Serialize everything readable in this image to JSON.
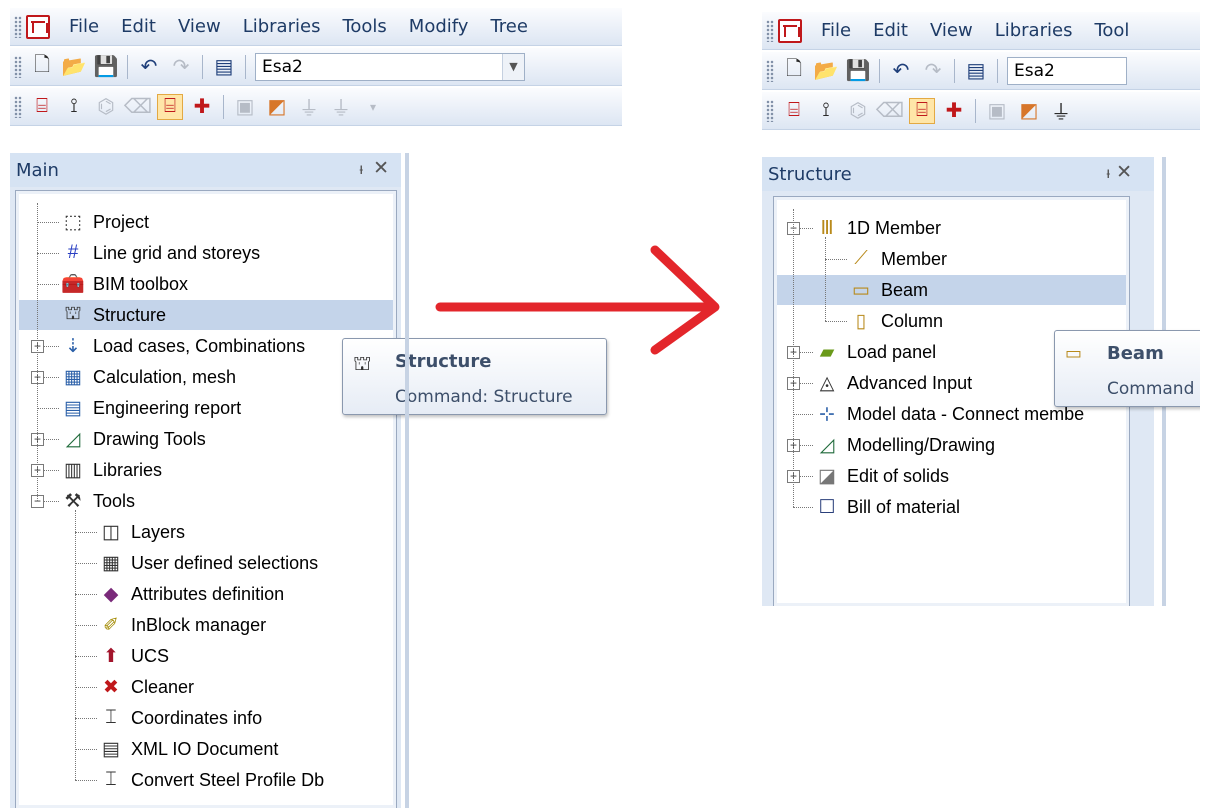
{
  "left": {
    "menu": [
      "File",
      "Edit",
      "View",
      "Libraries",
      "Tools",
      "Modify",
      "Tree"
    ],
    "project_combo": "Esa2",
    "panel_title": "Main",
    "tree": [
      {
        "label": "Project",
        "icon": "project-icon"
      },
      {
        "label": "Line grid and storeys",
        "icon": "grid-icon"
      },
      {
        "label": "BIM toolbox",
        "icon": "toolbox-icon"
      },
      {
        "label": "Structure",
        "icon": "structure-icon",
        "selected": true
      },
      {
        "label": "Load cases, Combinations",
        "icon": "load-icon",
        "expander": "+"
      },
      {
        "label": "Calculation, mesh",
        "icon": "calculator-icon",
        "expander": "+"
      },
      {
        "label": "Engineering report",
        "icon": "report-icon"
      },
      {
        "label": "Drawing Tools",
        "icon": "drawing-icon",
        "expander": "+"
      },
      {
        "label": "Libraries",
        "icon": "library-icon",
        "expander": "+"
      },
      {
        "label": "Tools",
        "icon": "tools-icon",
        "expander": "−"
      },
      {
        "label": "Layers",
        "icon": "layers-icon",
        "child": true
      },
      {
        "label": "User defined selections",
        "icon": "selection-icon",
        "child": true
      },
      {
        "label": "Attributes definition",
        "icon": "attributes-icon",
        "child": true
      },
      {
        "label": "InBlock manager",
        "icon": "inblock-icon",
        "child": true
      },
      {
        "label": "UCS",
        "icon": "ucs-icon",
        "child": true
      },
      {
        "label": "Cleaner",
        "icon": "cleaner-icon",
        "child": true
      },
      {
        "label": "Coordinates info",
        "icon": "coordinates-icon",
        "child": true
      },
      {
        "label": "XML IO Document",
        "icon": "xml-icon",
        "child": true
      },
      {
        "label": "Convert Steel Profile Db",
        "icon": "steel-profile-icon",
        "child": true
      }
    ],
    "tooltip": {
      "title": "Structure",
      "command": "Command: Structure"
    }
  },
  "right": {
    "menu": [
      "File",
      "Edit",
      "View",
      "Libraries",
      "Tool"
    ],
    "project_combo": "Esa2",
    "panel_title": "Structure",
    "tree": [
      {
        "label": "1D Member",
        "icon": "member-1d-icon",
        "expander": "−"
      },
      {
        "label": "Member",
        "icon": "member-icon",
        "child": true
      },
      {
        "label": "Beam",
        "icon": "beam-icon",
        "child": true,
        "selected": true
      },
      {
        "label": "Column",
        "icon": "column-icon",
        "child": true
      },
      {
        "label": "Load panel",
        "icon": "load-panel-icon",
        "expander": "+"
      },
      {
        "label": "Advanced Input",
        "icon": "advanced-input-icon",
        "expander": "+"
      },
      {
        "label": "Model data - Connect membe",
        "icon": "connect-icon"
      },
      {
        "label": "Modelling/Drawing",
        "icon": "modelling-icon",
        "expander": "+"
      },
      {
        "label": "Edit of solids",
        "icon": "solids-icon",
        "expander": "+"
      },
      {
        "label": "Bill of material",
        "icon": "bill-icon"
      }
    ],
    "tooltip": {
      "title": "Beam",
      "command": "Command"
    }
  },
  "colors": {
    "arrow": "#e3262b",
    "selection": "#c4d4ea",
    "accent_red": "#c0181b"
  }
}
